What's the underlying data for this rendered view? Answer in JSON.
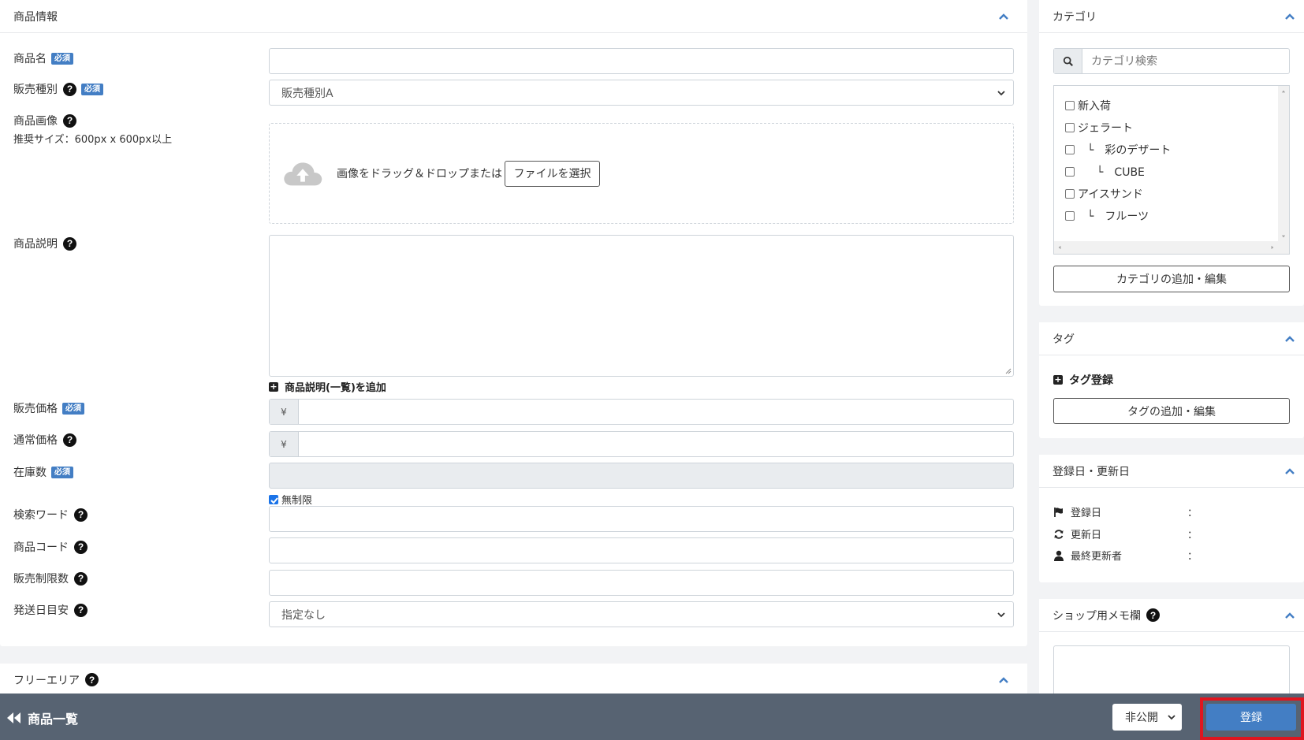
{
  "product": {
    "title": "商品情報",
    "required_badge": "必須",
    "name_label": "商品名",
    "sale_type_label": "販売種別",
    "sale_type_value": "販売種別A",
    "image_label": "商品画像",
    "image_note": "推奨サイズ：600px x 600px以上",
    "drop_text": "画像をドラッグ＆ドロップまたは",
    "file_button": "ファイルを選択",
    "description_label": "商品説明",
    "add_list_description": "商品説明(一覧)を追加",
    "price_label": "販売価格",
    "normal_price_label": "通常価格",
    "currency": "¥",
    "stock_label": "在庫数",
    "unlimited_label": "無制限",
    "search_word_label": "検索ワード",
    "code_label": "商品コード",
    "sale_limit_label": "販売制限数",
    "delivery_label": "発送日目安",
    "delivery_value": "指定なし"
  },
  "free_area": {
    "title": "フリーエリア"
  },
  "category": {
    "title": "カテゴリ",
    "search_placeholder": "カテゴリ検索",
    "items": [
      {
        "label": "新入荷"
      },
      {
        "label": "ジェラート"
      },
      {
        "label": "└　彩のデザート"
      },
      {
        "label": "└　CUBE"
      },
      {
        "label": "アイスサンド"
      },
      {
        "label": "└　フルーツ"
      }
    ],
    "edit_button": "カテゴリの追加・編集"
  },
  "tag": {
    "title": "タグ",
    "register_link": "タグ登録",
    "edit_button": "タグの追加・編集"
  },
  "dates": {
    "title": "登録日・更新日",
    "created_label": "登録日",
    "updated_label": "更新日",
    "last_editor_label": "最終更新者",
    "colon": "："
  },
  "memo": {
    "title": "ショップ用メモ欄"
  },
  "footer": {
    "back_label": "商品一覧",
    "visibility_value": "非公開",
    "register_button": "登録"
  },
  "colors": {
    "accent": "#437ec4",
    "footer_bg": "#576372",
    "highlight": "#e0161f"
  }
}
